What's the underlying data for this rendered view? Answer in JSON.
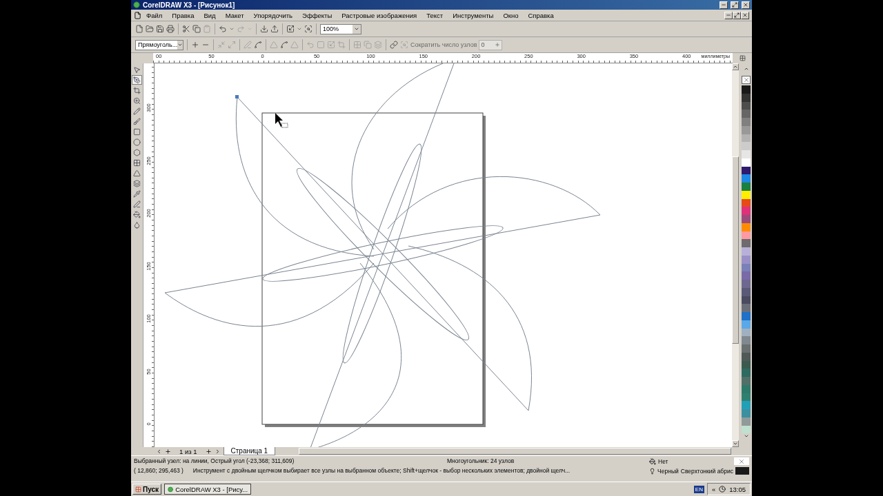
{
  "window": {
    "title": "CorelDRAW X3 - [Рисунок1]"
  },
  "menu": [
    "Файл",
    "Правка",
    "Вид",
    "Макет",
    "Упорядочить",
    "Эффекты",
    "Растровые изображения",
    "Текст",
    "Инструменты",
    "Окно",
    "Справка"
  ],
  "standard_toolbar": {
    "zoom": "100%"
  },
  "property_bar": {
    "object_type": "Прямоуголь...",
    "reduce_nodes_label": "Сократить число узлов",
    "reduce_nodes_value": "0"
  },
  "horizontal_ruler": {
    "labels": [
      "00",
      "50",
      "0",
      "50",
      "100",
      "150",
      "200",
      "250",
      "300",
      "350",
      "400"
    ],
    "unit": "миллиметры"
  },
  "vertical_ruler": {
    "labels": [
      "300",
      "250",
      "200",
      "150",
      "100",
      "50",
      "0"
    ]
  },
  "toolbox": [
    {
      "selected": false
    },
    {
      "selected": true
    },
    {
      "selected": false
    },
    {
      "selected": false
    },
    {
      "selected": false
    },
    {
      "selected": false
    },
    {
      "selected": false
    },
    {
      "selected": false
    },
    {
      "selected": false
    },
    {
      "selected": false
    },
    {
      "selected": false
    },
    {
      "selected": false
    },
    {
      "selected": false
    },
    {
      "selected": false
    },
    {
      "selected": false
    },
    {
      "selected": false
    }
  ],
  "palette": [
    {
      "color": "#1a1a1a"
    },
    {
      "color": "#333333"
    },
    {
      "color": "#4d4d4d"
    },
    {
      "color": "#666666"
    },
    {
      "color": "#808080"
    },
    {
      "color": "#999999"
    },
    {
      "color": "#b3b3b3"
    },
    {
      "color": "#cccccc"
    },
    {
      "color": "#e6e6e6"
    },
    {
      "color": "#ffffff"
    },
    {
      "color": "#2e1a6e"
    },
    {
      "color": "#1e88e5"
    },
    {
      "color": "#1a8040"
    },
    {
      "color": "#ffee00"
    },
    {
      "color": "#e64a19"
    },
    {
      "color": "#e0307a"
    },
    {
      "color": "#9c4a7a"
    },
    {
      "color": "#ff8c00"
    },
    {
      "color": "#ff9aa2"
    },
    {
      "color": "#6e6a6e"
    },
    {
      "color": "#b8b0d8"
    },
    {
      "color": "#9a90c8"
    },
    {
      "color": "#7a80b8"
    },
    {
      "color": "#7a6aa8"
    },
    {
      "color": "#6e6890"
    },
    {
      "color": "#5a5a78"
    },
    {
      "color": "#4a4a60"
    },
    {
      "color": "#6a6e78"
    },
    {
      "color": "#1e70c8"
    },
    {
      "color": "#5aa8e8"
    },
    {
      "color": "#a0b0c0"
    },
    {
      "color": "#808890"
    },
    {
      "color": "#6a7070"
    },
    {
      "color": "#505858"
    },
    {
      "color": "#3a5a50"
    },
    {
      "color": "#2e6a60"
    },
    {
      "color": "#507068"
    },
    {
      "color": "#2e7a6a"
    },
    {
      "color": "#308070"
    },
    {
      "color": "#20a0b8"
    },
    {
      "color": "#3a90a0"
    },
    {
      "color": "#909a98"
    },
    {
      "color": "#c0e0d0"
    }
  ],
  "page_nav": {
    "counter": "1 из 1",
    "tabs": [
      {
        "label": "Страница 1",
        "selected": true
      }
    ]
  },
  "status_bar": {
    "line1": "Выбранный узел: на линии, Острый угол (-23,368; 311,609)",
    "object_info": "Многоугольник: 24 узлов",
    "coords": "( 12,860; 295,463 )",
    "hint": "Инструмент с двойным щелчком выбирает все узлы на выбранном объекте; Shift+щелчок - выбор нескольких элементов; двойной щелч...",
    "fill": "Нет",
    "outline_color": "Черный",
    "outline_width": "Сверхтонкий абрис"
  },
  "taskbar": {
    "start": "Пуск",
    "tasks": [
      {
        "label": "CorelDRAW X3 - [Рису...",
        "selected": true
      }
    ],
    "language": "EN",
    "tray_arrows": "«",
    "clock": "13:05"
  }
}
